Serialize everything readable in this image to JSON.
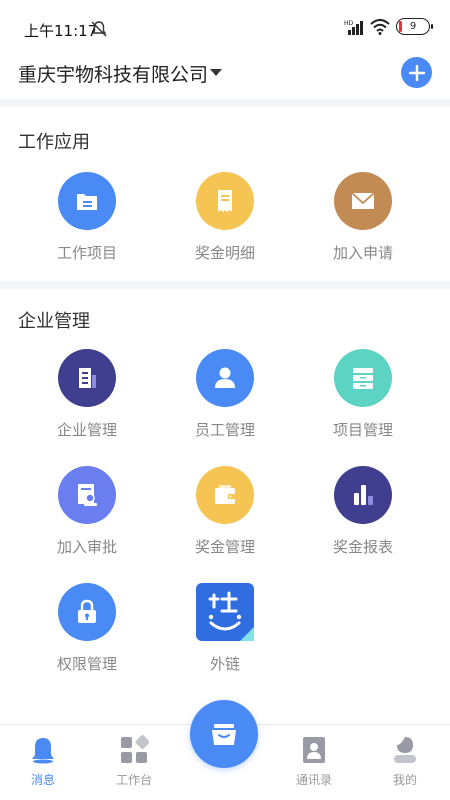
{
  "status_bar": {
    "time": "上午11:17",
    "battery": "9"
  },
  "header": {
    "company": "重庆宇物科技有限公司"
  },
  "sections": [
    {
      "title": "工作应用",
      "items": [
        {
          "label": "工作项目",
          "icon": "folder-icon",
          "color": "#4a8af4"
        },
        {
          "label": "奖金明细",
          "icon": "receipt-icon",
          "color": "#f6c453"
        },
        {
          "label": "加入申请",
          "icon": "envelope-icon",
          "color": "#c38b54"
        }
      ]
    },
    {
      "title": "企业管理",
      "items": [
        {
          "label": "企业管理",
          "icon": "building-icon",
          "color": "#3f3e8f"
        },
        {
          "label": "员工管理",
          "icon": "person-icon",
          "color": "#4a8af4"
        },
        {
          "label": "项目管理",
          "icon": "cabinet-icon",
          "color": "#5dd3c3"
        },
        {
          "label": "加入审批",
          "icon": "approval-stamp-icon",
          "color": "#6b7ef0"
        },
        {
          "label": "奖金管理",
          "icon": "wallet-icon",
          "color": "#f6c453"
        },
        {
          "label": "奖金报表",
          "icon": "bar-chart-icon",
          "color": "#3f3e8f"
        },
        {
          "label": "权限管理",
          "icon": "lock-icon",
          "color": "#4a8af4"
        },
        {
          "label": "外链",
          "icon": "external-link-logo-icon",
          "color": "#2f6de0"
        }
      ]
    }
  ],
  "tab_bar": {
    "tabs": [
      {
        "label": "消息",
        "icon": "bell-icon",
        "active": true
      },
      {
        "label": "工作台",
        "icon": "grid-icon",
        "active": false
      },
      {
        "label": "通讯录",
        "icon": "contacts-icon",
        "active": false
      },
      {
        "label": "我的",
        "icon": "profile-icon",
        "active": false
      }
    ],
    "center_icon": "inbox-tray-icon"
  },
  "colors": {
    "accent": "#4a8af4",
    "divider": "#f4f5f9",
    "label_gray": "#888888"
  }
}
